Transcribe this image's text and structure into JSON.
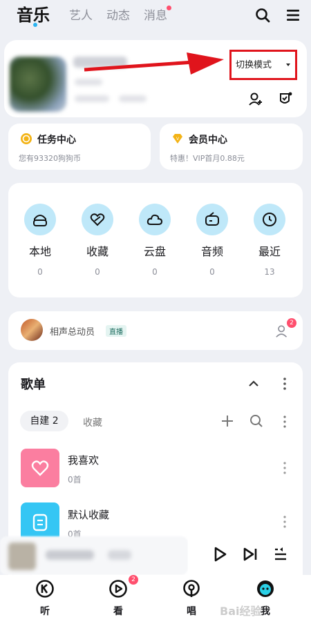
{
  "header": {
    "tabs": [
      {
        "label": "音乐"
      },
      {
        "label": "艺人"
      },
      {
        "label": "动态"
      },
      {
        "label": "消息"
      }
    ]
  },
  "profile": {
    "mode_label": "切换模式"
  },
  "task_center": {
    "title": "任务中心",
    "subtitle": "您有93320狗狗币"
  },
  "vip_center": {
    "title": "会员中心",
    "subtitle": "特惠！VIP首月0.88元"
  },
  "quick": [
    {
      "label": "本地",
      "count": "0",
      "icon": "headphones-icon"
    },
    {
      "label": "收藏",
      "count": "0",
      "icon": "heart-icon"
    },
    {
      "label": "云盘",
      "count": "0",
      "icon": "cloud-icon"
    },
    {
      "label": "音频",
      "count": "0",
      "icon": "radio-icon"
    },
    {
      "label": "最近",
      "count": "13",
      "icon": "clock-icon"
    }
  ],
  "live": {
    "name": "相声总动员",
    "badge": "直播",
    "notif_count": "2"
  },
  "playlist": {
    "title": "歌单",
    "tab_created": "自建 2",
    "tab_collected": "收藏",
    "items": [
      {
        "name": "我喜欢",
        "count": "0首"
      },
      {
        "name": "默认收藏",
        "count": "0首"
      }
    ]
  },
  "nav": [
    {
      "label": "听"
    },
    {
      "label": "看",
      "badge": "2"
    },
    {
      "label": "唱"
    },
    {
      "label": "我"
    }
  ],
  "watermark": "Bai经验",
  "colors": {
    "accent": "#2bb3f0",
    "badge": "#ff4f6e",
    "highlight_frame": "#e0141c",
    "quick_bg": "#bfe8f9"
  }
}
